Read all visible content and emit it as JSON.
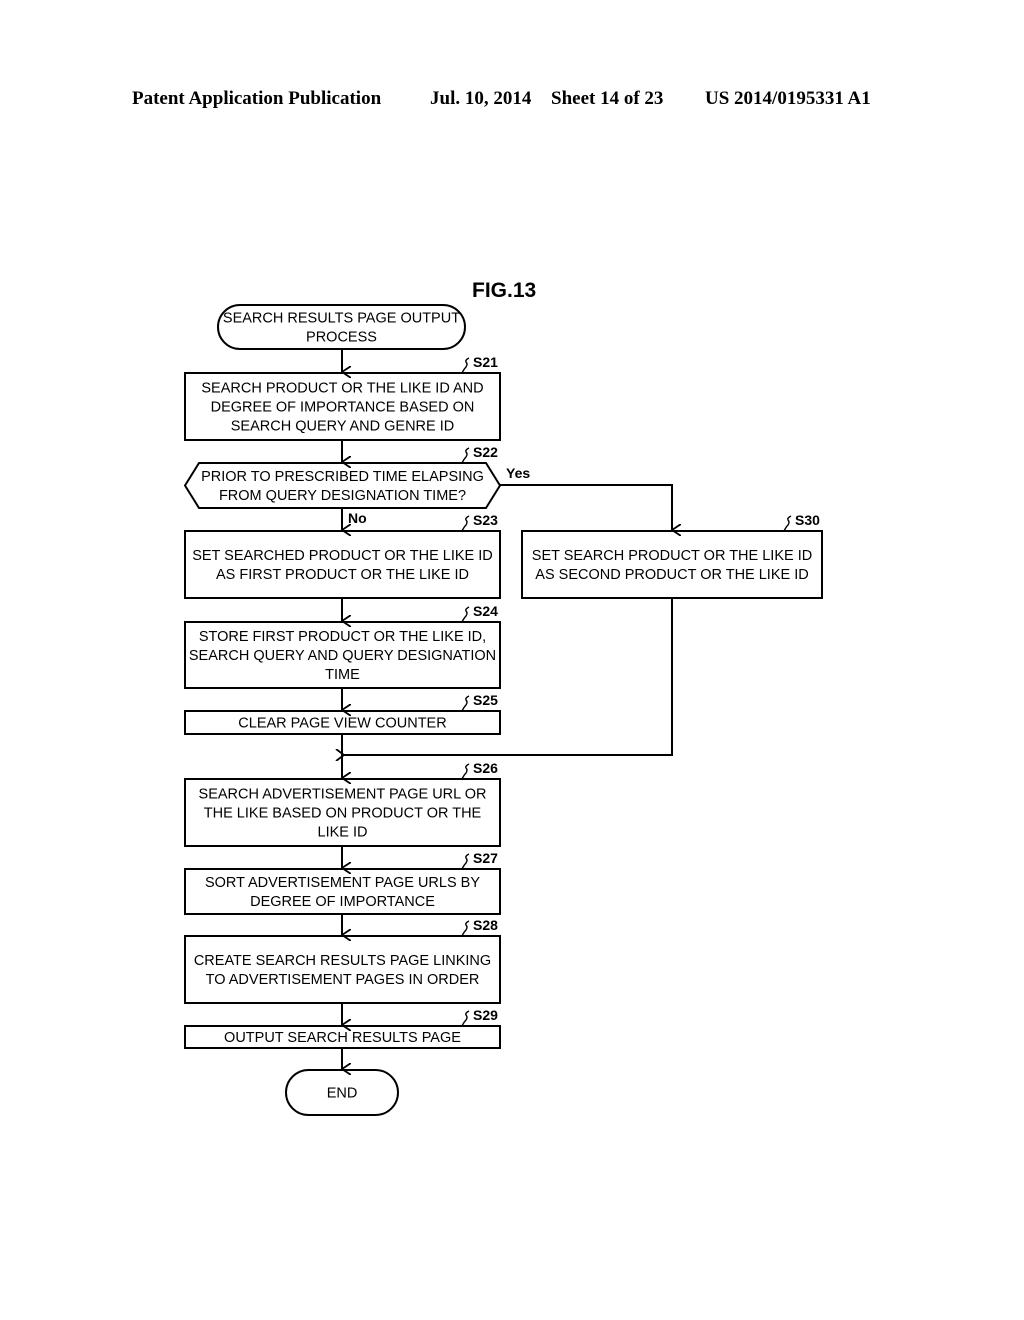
{
  "header": {
    "publication": "Patent Application Publication",
    "date": "Jul. 10, 2014",
    "sheet": "Sheet 14 of 23",
    "number": "US 2014/0195331 A1"
  },
  "figure": {
    "title": "FIG.13",
    "start": {
      "lines": [
        "SEARCH RESULTS PAGE OUTPUT",
        "PROCESS"
      ]
    },
    "end": {
      "lines": [
        "END"
      ]
    },
    "steps": [
      {
        "id": "S21",
        "type": "process",
        "lines": [
          "SEARCH PRODUCT OR THE LIKE ID AND",
          "DEGREE OF IMPORTANCE BASED ON",
          "SEARCH QUERY AND GENRE ID"
        ]
      },
      {
        "id": "S22",
        "type": "decision",
        "lines": [
          "PRIOR TO PRESCRIBED TIME ELAPSING",
          "FROM QUERY DESIGNATION TIME?"
        ]
      },
      {
        "id": "S23",
        "type": "process",
        "lines": [
          "SET SEARCHED PRODUCT OR THE LIKE ID",
          "AS FIRST PRODUCT OR THE LIKE ID"
        ]
      },
      {
        "id": "S24",
        "type": "process",
        "lines": [
          "STORE FIRST PRODUCT OR THE LIKE ID,",
          "SEARCH QUERY AND QUERY DESIGNATION",
          "TIME"
        ]
      },
      {
        "id": "S25",
        "type": "process",
        "lines": [
          "CLEAR PAGE VIEW COUNTER"
        ]
      },
      {
        "id": "S26",
        "type": "process",
        "lines": [
          "SEARCH ADVERTISEMENT PAGE URL OR",
          "THE LIKE BASED ON PRODUCT OR THE",
          "LIKE ID"
        ]
      },
      {
        "id": "S27",
        "type": "process",
        "lines": [
          "SORT ADVERTISEMENT PAGE URLS BY",
          "DEGREE OF IMPORTANCE"
        ]
      },
      {
        "id": "S28",
        "type": "process",
        "lines": [
          "CREATE SEARCH RESULTS PAGE LINKING",
          "TO ADVERTISEMENT PAGES IN ORDER"
        ]
      },
      {
        "id": "S29",
        "type": "process",
        "lines": [
          "OUTPUT SEARCH RESULTS PAGE"
        ]
      },
      {
        "id": "S30",
        "type": "process",
        "lines": [
          "SET SEARCH PRODUCT OR THE LIKE ID",
          "AS SECOND PRODUCT OR THE LIKE ID"
        ]
      }
    ],
    "branches": {
      "yes": "Yes",
      "no": "No"
    }
  }
}
